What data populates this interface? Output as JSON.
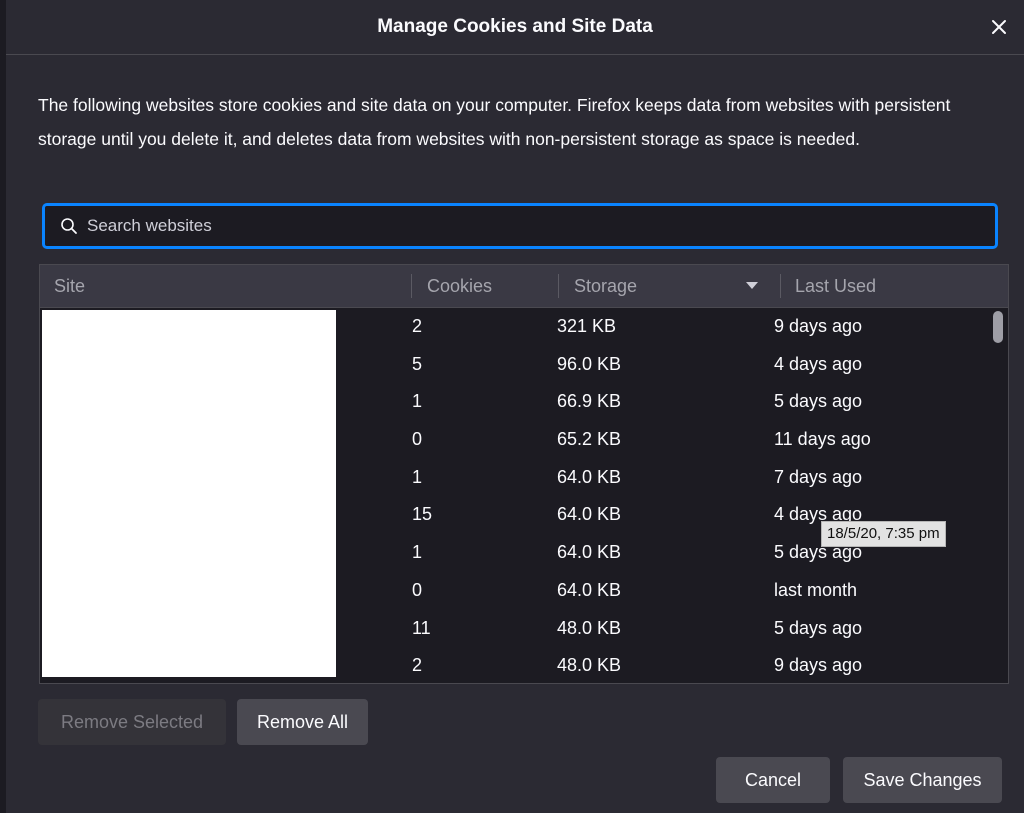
{
  "dialog": {
    "title": "Manage Cookies and Site Data",
    "description": "The following websites store cookies and site data on your computer. Firefox keeps data from websites with persistent storage until you delete it, and deletes data from websites with non-persistent storage as space is needed."
  },
  "search": {
    "placeholder": "Search websites",
    "value": ""
  },
  "table": {
    "columns": {
      "site": "Site",
      "cookies": "Cookies",
      "storage": "Storage",
      "last_used": "Last Used"
    },
    "rows": [
      {
        "cookies": "2",
        "storage": "321 KB",
        "last_used": "9 days ago"
      },
      {
        "cookies": "5",
        "storage": "96.0 KB",
        "last_used": "4 days ago"
      },
      {
        "cookies": "1",
        "storage": "66.9 KB",
        "last_used": "5 days ago"
      },
      {
        "cookies": "0",
        "storage": "65.2 KB",
        "last_used": "11 days ago"
      },
      {
        "cookies": "1",
        "storage": "64.0 KB",
        "last_used": "7 days ago"
      },
      {
        "cookies": "15",
        "storage": "64.0 KB",
        "last_used": "4 days ago"
      },
      {
        "cookies": "1",
        "storage": "64.0 KB",
        "last_used": "5 days ago"
      },
      {
        "cookies": "0",
        "storage": "64.0 KB",
        "last_used": "last month"
      },
      {
        "cookies": "11",
        "storage": "48.0 KB",
        "last_used": "5 days ago"
      },
      {
        "cookies": "2",
        "storage": "48.0 KB",
        "last_used": "9 days ago"
      }
    ],
    "tooltip": "18/5/20, 7:35 pm"
  },
  "buttons": {
    "remove_selected": "Remove Selected",
    "remove_all": "Remove All",
    "cancel": "Cancel",
    "save_changes": "Save Changes"
  },
  "colors": {
    "accent": "#0a84ff",
    "background": "#2b2a33",
    "list_background": "#1c1b22"
  }
}
